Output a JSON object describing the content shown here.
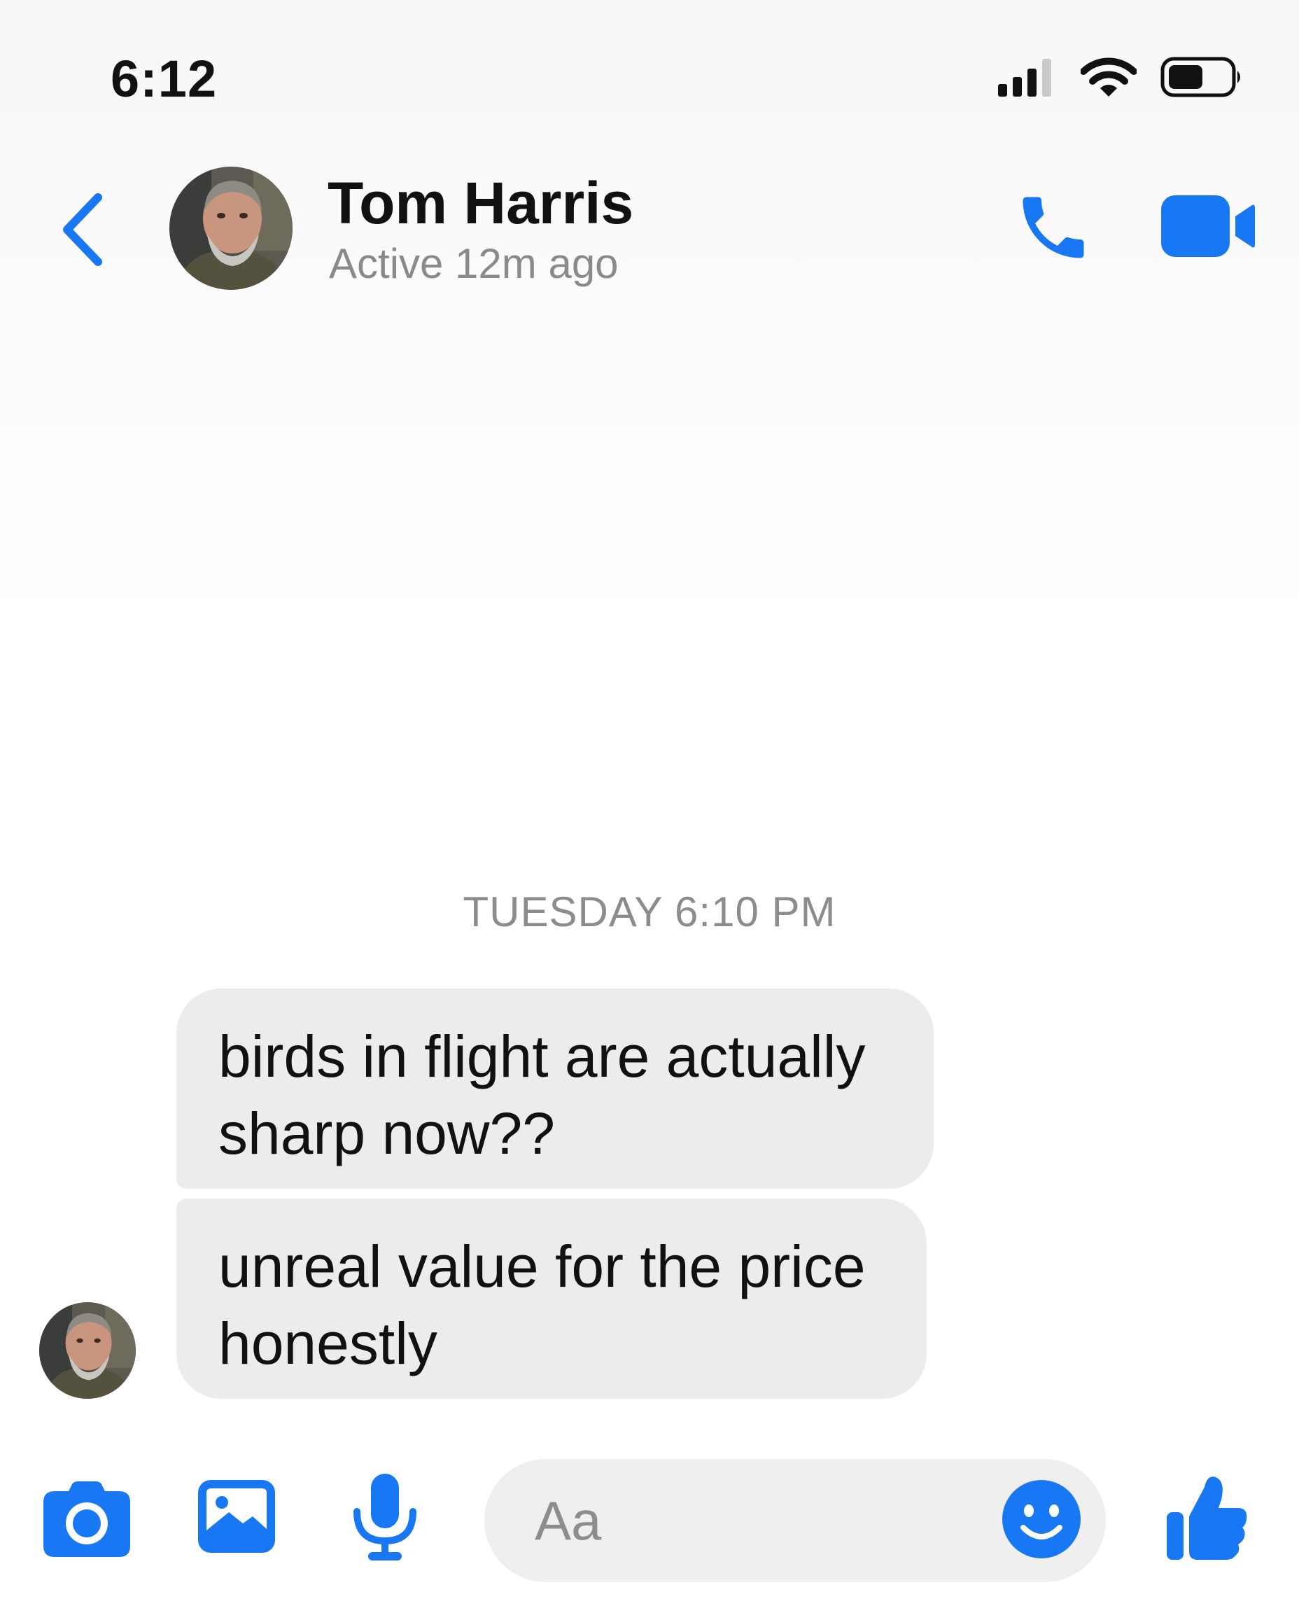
{
  "status_bar": {
    "time": "6:12",
    "icons": [
      "cellular-signal-icon",
      "wifi-icon",
      "battery-icon"
    ]
  },
  "header": {
    "contact_name": "Tom Harris",
    "contact_status": "Active 12m ago",
    "actions": [
      "back-chevron-icon",
      "phone-icon",
      "video-camera-icon"
    ]
  },
  "conversation": {
    "timestamp": "TUESDAY 6:10 PM",
    "messages": [
      {
        "sender": "Tom Harris",
        "text": "birds in flight are actually sharp now??"
      },
      {
        "sender": "Tom Harris",
        "text": "unreal value for the price honestly"
      }
    ]
  },
  "composer": {
    "placeholder": "Aa",
    "value": "",
    "icons": [
      "camera-icon",
      "image-icon",
      "microphone-icon",
      "emoji-icon",
      "thumbs-up-icon"
    ]
  },
  "colors": {
    "accent": "#1877f2",
    "incoming_bubble": "#ececec",
    "secondary_text": "#8a8a8a"
  }
}
